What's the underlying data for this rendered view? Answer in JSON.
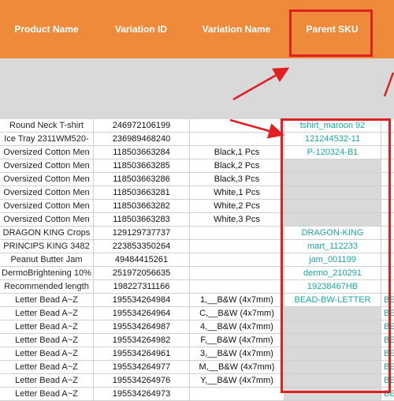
{
  "header": {
    "columns": [
      "Product Name",
      "Variation ID",
      "Variation Name",
      "Parent SKU"
    ]
  },
  "colors": {
    "header_bg": "#ef8a3a",
    "sku_text": "#1aa8a0",
    "highlight": "#e02020",
    "gray_fill": "#d9d9d9"
  },
  "rows": [
    {
      "name": "Round Neck T-shirt",
      "var_id": "246972106199",
      "var_name": "",
      "sku": "tshirt_maroon 92",
      "extra": ""
    },
    {
      "name": "Ice Tray 2311WM520-",
      "var_id": "236989468240",
      "var_name": "",
      "sku": "121244532-11",
      "extra": ""
    },
    {
      "name": "Oversized Cotton Men",
      "var_id": "118503663284",
      "var_name": "Black,1 Pcs",
      "sku": "P-120324-B1",
      "extra": ""
    },
    {
      "name": "Oversized Cotton Men",
      "var_id": "118503663285",
      "var_name": "Black,2 Pcs",
      "sku": "",
      "extra": ""
    },
    {
      "name": "Oversized Cotton Men",
      "var_id": "118503663286",
      "var_name": "Black,3 Pcs",
      "sku": "",
      "extra": ""
    },
    {
      "name": "Oversized Cotton Men",
      "var_id": "118503663281",
      "var_name": "White,1 Pcs",
      "sku": "",
      "extra": ""
    },
    {
      "name": "Oversized Cotton Men",
      "var_id": "118503663282",
      "var_name": "White,2 Pcs",
      "sku": "",
      "extra": ""
    },
    {
      "name": "Oversized Cotton Men",
      "var_id": "118503663283",
      "var_name": "White,3 Pcs",
      "sku": "",
      "extra": ""
    },
    {
      "name": "DRAGON KING Crops",
      "var_id": "129129737737",
      "var_name": "",
      "sku": "DRAGON-KING",
      "extra": ""
    },
    {
      "name": "PRINCIPS KING 3482",
      "var_id": "223853350264",
      "var_name": "",
      "sku": "mart_112233",
      "extra": ""
    },
    {
      "name": "Peanut Butter Jam",
      "var_id": "49484415261",
      "var_name": "",
      "sku": "jam_001199",
      "extra": ""
    },
    {
      "name": "DermoBrightening 10%",
      "var_id": "251972056635",
      "var_name": "",
      "sku": "dermo_210291",
      "extra": ""
    },
    {
      "name": "Recommended length",
      "var_id": "198227311166",
      "var_name": "",
      "sku": "19238467HB",
      "extra": ""
    },
    {
      "name": "Letter Bead A~Z",
      "var_id": "195534264984",
      "var_name": "1,__B&W (4x7mm)",
      "sku": "BEAD-BW-LETTER",
      "extra": "BE"
    },
    {
      "name": "Letter Bead A~Z",
      "var_id": "195534264964",
      "var_name": "C,__B&W (4x7mm)",
      "sku": "",
      "extra": "BE"
    },
    {
      "name": "Letter Bead A~Z",
      "var_id": "195534264987",
      "var_name": "4,__B&W (4x7mm)",
      "sku": "",
      "extra": "BE"
    },
    {
      "name": "Letter Bead A~Z",
      "var_id": "195534264982",
      "var_name": "F,__B&W (4x7mm)",
      "sku": "",
      "extra": "BE"
    },
    {
      "name": "Letter Bead A~Z",
      "var_id": "195534264961",
      "var_name": "3,__B&W (4x7mm)",
      "sku": "",
      "extra": "BE"
    },
    {
      "name": "Letter Bead A~Z",
      "var_id": "195534264977",
      "var_name": "M,__B&W (4x7mm)",
      "sku": "",
      "extra": "BE"
    },
    {
      "name": "Letter Bead A~Z",
      "var_id": "195534264976",
      "var_name": "Y,__B&W (4x7mm)",
      "sku": "",
      "extra": "BE"
    },
    {
      "name": "Letter Bead A~Z",
      "var_id": "195534264973",
      "var_name": "",
      "sku": "",
      "extra": "BE"
    }
  ]
}
